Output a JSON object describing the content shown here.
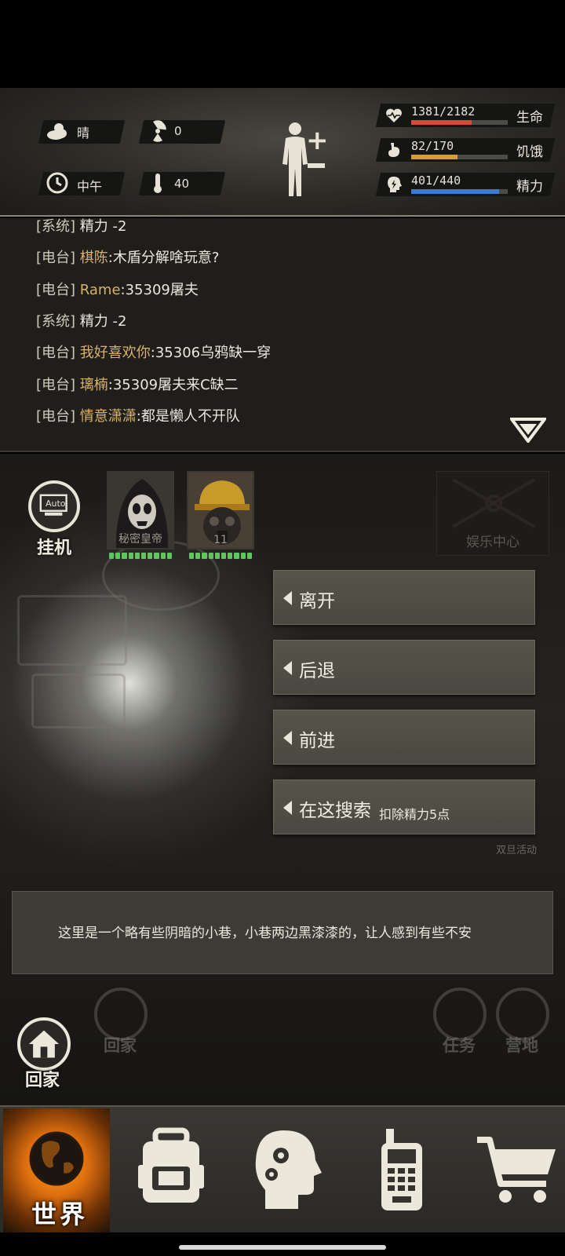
{
  "status": {
    "weather": "晴",
    "radiation": "0",
    "time_of_day": "中午",
    "temperature": "40",
    "stats": [
      {
        "name": "生命",
        "value": "1381/2182",
        "fill": 0.63,
        "color": "#d64a3a",
        "icon": "heart-icon"
      },
      {
        "name": "饥饿",
        "value": "82/170",
        "fill": 0.48,
        "color": "#d89a3a",
        "icon": "stomach-icon"
      },
      {
        "name": "精力",
        "value": "401/440",
        "fill": 0.91,
        "color": "#3a7ad0",
        "icon": "head-energy-icon"
      }
    ]
  },
  "chat": {
    "lines": [
      {
        "tag": "[系统]",
        "name": "",
        "msg": "精力 -2"
      },
      {
        "tag": "[电台]",
        "name": "棋陈",
        "msg": ":木盾分解啥玩意?"
      },
      {
        "tag": "[电台]",
        "name": "Rame",
        "msg": ":35309屠夫"
      },
      {
        "tag": "[系统]",
        "name": "",
        "msg": "精力 -2"
      },
      {
        "tag": "[电台]",
        "name": "我好喜欢你",
        "msg": ":35306乌鸦缺一穿"
      },
      {
        "tag": "[电台]",
        "name": "璃楠",
        "msg": ":35309屠夫来C缺二"
      },
      {
        "tag": "[电台]",
        "name": "情意潇潇",
        "msg": ":都是懒人不开队"
      }
    ]
  },
  "scene": {
    "auto_icon_text": "Auto",
    "auto_label": "挂机",
    "party": [
      {
        "name": "秘密皇帝",
        "hp_fill": 1.0
      },
      {
        "name": "11",
        "hp_fill": 1.0
      }
    ],
    "fun_center": "娱乐中心",
    "actions": [
      {
        "label": "离开",
        "sub": ""
      },
      {
        "label": "后退",
        "sub": ""
      },
      {
        "label": "前进",
        "sub": ""
      },
      {
        "label": "在这搜索",
        "sub": "扣除精力5点"
      }
    ],
    "side_labels": [
      "双旦活动"
    ],
    "description": "这里是一个略有些阴暗的小巷，小巷两边黑漆漆的，让人感到有些不安",
    "bottom_buttons": {
      "home": "回家",
      "home_faded": "回家",
      "task": "任务",
      "camp": "营地"
    }
  },
  "nav": {
    "world": "世界",
    "items": [
      "backpack-icon",
      "skills-head-icon",
      "radio-icon",
      "cart-icon"
    ]
  }
}
